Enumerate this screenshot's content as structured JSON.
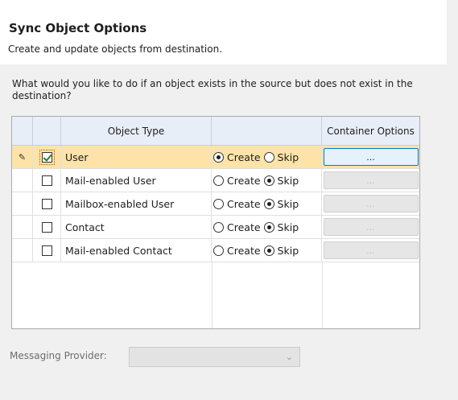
{
  "header": {
    "title": "Sync Object Options",
    "subtitle": "Create and update objects from destination."
  },
  "question": "What would you like to do if an object exists in the source but does not exist in the destination?",
  "grid": {
    "columns": [
      "",
      "",
      "Object Type",
      "",
      "Container Options"
    ],
    "radio_labels": {
      "create": "Create",
      "skip": "Skip"
    },
    "rows": [
      {
        "type": "User",
        "checked": true,
        "action": "Create",
        "button": "...",
        "selected": true
      },
      {
        "type": "Mail-enabled User",
        "checked": false,
        "action": "Skip",
        "button": "...",
        "selected": false
      },
      {
        "type": "Mailbox-enabled User",
        "checked": false,
        "action": "Skip",
        "button": "...",
        "selected": false
      },
      {
        "type": "Contact",
        "checked": false,
        "action": "Skip",
        "button": "...",
        "selected": false
      },
      {
        "type": "Mail-enabled Contact",
        "checked": false,
        "action": "Skip",
        "button": "...",
        "selected": false
      }
    ]
  },
  "messaging_provider": {
    "label": "Messaging Provider:",
    "value": ""
  }
}
